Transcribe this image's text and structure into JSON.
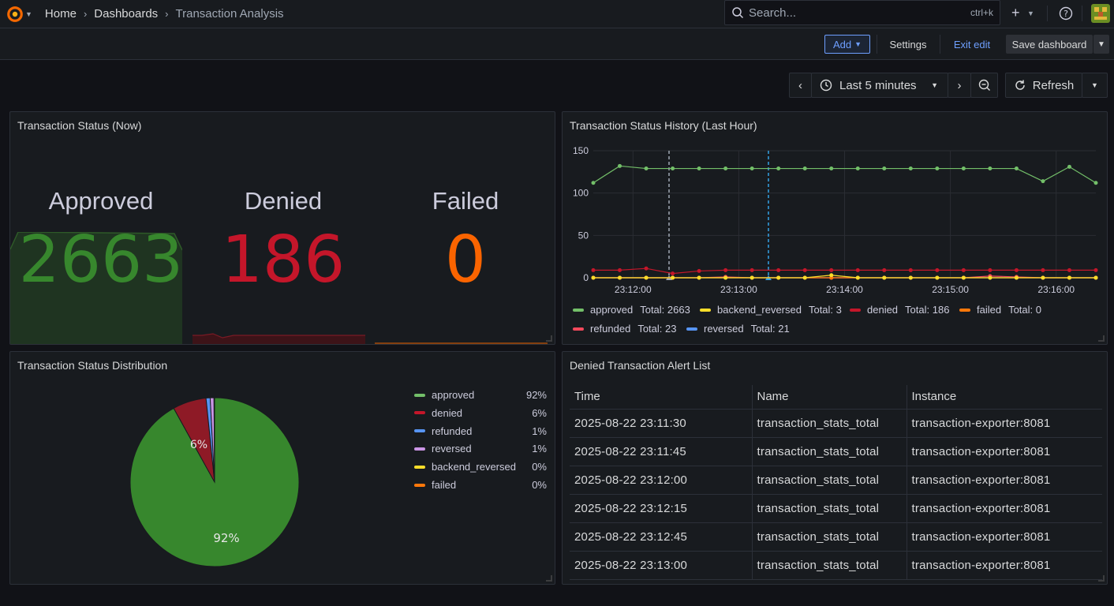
{
  "breadcrumb": {
    "home": "Home",
    "dashboards": "Dashboards",
    "current": "Transaction Analysis"
  },
  "search": {
    "placeholder": "Search...",
    "shortcut": "ctrl+k"
  },
  "toolbar": {
    "add": "Add",
    "settings": "Settings",
    "exit_edit": "Exit edit",
    "save": "Save dashboard"
  },
  "time": {
    "range": "Last 5 minutes",
    "refresh": "Refresh"
  },
  "panels": {
    "stat": {
      "title": "Transaction Status (Now)",
      "items": [
        {
          "label": "Approved",
          "value": "2663",
          "color": "#37872d"
        },
        {
          "label": "Denied",
          "value": "186",
          "color": "#c4162a"
        },
        {
          "label": "Failed",
          "value": "0",
          "color": "#fa6400"
        }
      ]
    },
    "history": {
      "title": "Transaction Status History (Last Hour)",
      "y_ticks": [
        "150",
        "100",
        "50",
        "0"
      ],
      "x_ticks": [
        "23:12:00",
        "23:13:00",
        "23:14:00",
        "23:15:00",
        "23:16:00"
      ],
      "legend": [
        {
          "name": "approved",
          "total": "Total: 2663",
          "color": "#73bf69"
        },
        {
          "name": "backend_reversed",
          "total": "Total: 3",
          "color": "#fade2a"
        },
        {
          "name": "denied",
          "total": "Total: 186",
          "color": "#c4162a"
        },
        {
          "name": "failed",
          "total": "Total: 0",
          "color": "#ff780a"
        },
        {
          "name": "refunded",
          "total": "Total: 23",
          "color": "#f2495c"
        },
        {
          "name": "reversed",
          "total": "Total: 21",
          "color": "#5794f2"
        }
      ]
    },
    "distribution": {
      "title": "Transaction Status Distribution",
      "labels": {
        "big": "92%",
        "small": "6%"
      },
      "legend": [
        {
          "name": "approved",
          "pct": "92%",
          "color": "#73bf69"
        },
        {
          "name": "denied",
          "pct": "6%",
          "color": "#c4162a"
        },
        {
          "name": "refunded",
          "pct": "1%",
          "color": "#5794f2"
        },
        {
          "name": "reversed",
          "pct": "1%",
          "color": "#ca95e5"
        },
        {
          "name": "backend_reversed",
          "pct": "0%",
          "color": "#fade2a"
        },
        {
          "name": "failed",
          "pct": "0%",
          "color": "#ff780a"
        }
      ]
    },
    "alerts": {
      "title": "Denied Transaction Alert List",
      "columns": [
        "Time",
        "Name",
        "Instance"
      ],
      "rows": [
        [
          "2025-08-22 23:11:30",
          "transaction_stats_total",
          "transaction-exporter:8081"
        ],
        [
          "2025-08-22 23:11:45",
          "transaction_stats_total",
          "transaction-exporter:8081"
        ],
        [
          "2025-08-22 23:12:00",
          "transaction_stats_total",
          "transaction-exporter:8081"
        ],
        [
          "2025-08-22 23:12:15",
          "transaction_stats_total",
          "transaction-exporter:8081"
        ],
        [
          "2025-08-22 23:12:45",
          "transaction_stats_total",
          "transaction-exporter:8081"
        ],
        [
          "2025-08-22 23:13:00",
          "transaction_stats_total",
          "transaction-exporter:8081"
        ]
      ]
    }
  },
  "chart_data": [
    {
      "type": "line",
      "x": [
        "23:11:30",
        "23:11:45",
        "23:12:00",
        "23:12:15",
        "23:12:30",
        "23:12:45",
        "23:13:00",
        "23:13:15",
        "23:13:30",
        "23:13:45",
        "23:14:00",
        "23:14:15",
        "23:14:30",
        "23:14:45",
        "23:15:00",
        "23:15:15",
        "23:15:30",
        "23:15:45",
        "23:16:00",
        "23:16:15"
      ],
      "ylim": [
        0,
        150
      ],
      "series": [
        {
          "name": "approved",
          "color": "#73bf69",
          "values": [
            112,
            132,
            129,
            129,
            129,
            129,
            129,
            129,
            129,
            129,
            129,
            129,
            129,
            129,
            129,
            129,
            129,
            114,
            131,
            112
          ]
        },
        {
          "name": "denied",
          "color": "#c4162a",
          "values": [
            9,
            9,
            11,
            5,
            8,
            9,
            9,
            9,
            9,
            9,
            9,
            9,
            9,
            9,
            9,
            9,
            9,
            9,
            9,
            9
          ]
        },
        {
          "name": "backend_reversed",
          "color": "#fade2a",
          "values": [
            0,
            0,
            0,
            0,
            0,
            0,
            0,
            0,
            0,
            3,
            0,
            0,
            0,
            0,
            0,
            0,
            0,
            0,
            0,
            0
          ]
        },
        {
          "name": "failed",
          "color": "#ff780a",
          "values": [
            0,
            0,
            0,
            0,
            0,
            0,
            0,
            0,
            0,
            0,
            0,
            0,
            0,
            0,
            0,
            0,
            0,
            0,
            0,
            0
          ]
        },
        {
          "name": "refunded",
          "color": "#f2495c",
          "values": [
            0,
            0,
            0,
            0,
            0,
            1,
            0,
            0,
            0,
            0,
            0,
            0,
            0,
            0,
            0,
            2,
            1,
            0,
            0,
            0
          ]
        },
        {
          "name": "reversed",
          "color": "#5794f2",
          "values": [
            0,
            0,
            0,
            0,
            0,
            0,
            0,
            0,
            0,
            0,
            0,
            0,
            0,
            0,
            0,
            0,
            0,
            0,
            0,
            0
          ]
        }
      ]
    },
    {
      "type": "pie",
      "categories": [
        "approved",
        "denied",
        "refunded",
        "reversed",
        "backend_reversed",
        "failed"
      ],
      "values": [
        92,
        6,
        1,
        1,
        0,
        0
      ],
      "colors": [
        "#37872d",
        "#8e1a26",
        "#5794f2",
        "#ca95e5",
        "#fade2a",
        "#ff780a"
      ]
    }
  ]
}
